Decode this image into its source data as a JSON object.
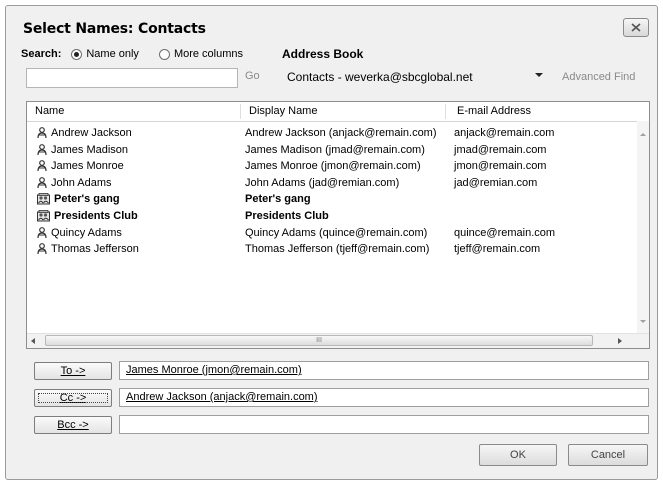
{
  "dialog": {
    "title": "Select Names: Contacts"
  },
  "search": {
    "label": "Search:",
    "option_name_only": "Name only",
    "option_more_columns": "More columns",
    "selected_option": "Name only",
    "input_value": "",
    "go_label": "Go"
  },
  "address_book": {
    "label": "Address Book",
    "selected": "Contacts - weverka@sbcglobal.net",
    "advanced_find": "Advanced Find"
  },
  "columns": {
    "name": "Name",
    "display_name": "Display Name",
    "email": "E-mail Address"
  },
  "contacts": [
    {
      "name": "Andrew Jackson",
      "display": "Andrew Jackson (anjack@remain.com)",
      "email": "anjack@remain.com",
      "type": "person-icon",
      "bold": false
    },
    {
      "name": "James Madison",
      "display": "James Madison (jmad@remain.com)",
      "email": "jmad@remain.com",
      "type": "person-icon",
      "bold": false
    },
    {
      "name": "James Monroe",
      "display": "James Monroe (jmon@remain.com)",
      "email": "jmon@remain.com",
      "type": "person-icon",
      "bold": false
    },
    {
      "name": "John Adams",
      "display": "John Adams (jad@remian.com)",
      "email": "jad@remian.com",
      "type": "person-icon",
      "bold": false
    },
    {
      "name": "Peter's gang",
      "display": "Peter's gang",
      "email": "",
      "type": "distribution-list-icon",
      "bold": true
    },
    {
      "name": "Presidents Club",
      "display": "Presidents Club",
      "email": "",
      "type": "distribution-list-icon",
      "bold": true
    },
    {
      "name": "Quincy Adams",
      "display": "Quincy Adams (quince@remain.com)",
      "email": "quince@remain.com",
      "type": "person-icon",
      "bold": false
    },
    {
      "name": "Thomas Jefferson",
      "display": "Thomas Jefferson (tjeff@remain.com)",
      "email": "tjeff@remain.com",
      "type": "person-icon",
      "bold": false
    }
  ],
  "scrollbar": {
    "thumb_grip": "III"
  },
  "recipients": {
    "to_label": "To ->",
    "to_value": "James Monroe (jmon@remain.com)",
    "cc_label": "Cc ->",
    "cc_value": "Andrew Jackson (anjack@remain.com)",
    "bcc_label": "Bcc ->",
    "bcc_value": ""
  },
  "buttons": {
    "ok": "OK",
    "cancel": "Cancel"
  }
}
